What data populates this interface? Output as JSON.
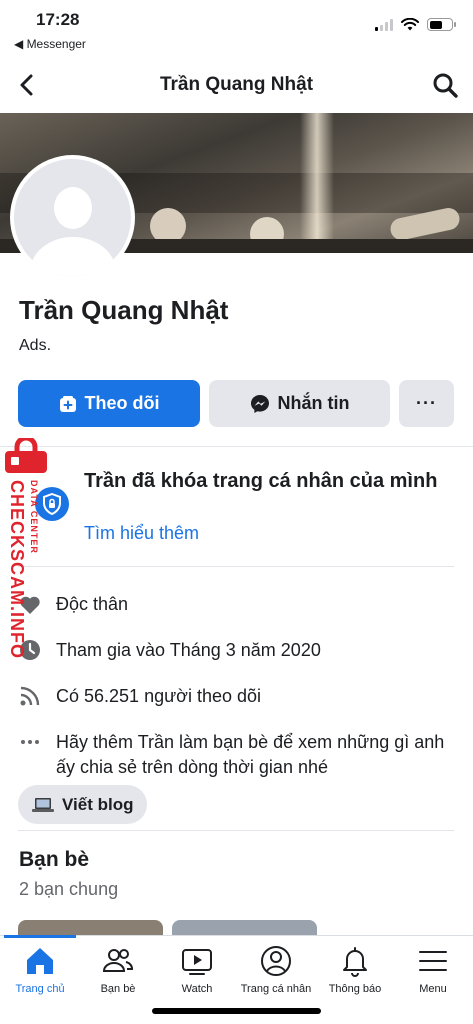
{
  "status_bar": {
    "time": "17:28",
    "back_app": "◀ Messenger",
    "signal_bars_filled": 1,
    "battery_level": 0.6
  },
  "header": {
    "title": "Trần Quang Nhật",
    "back_icon": "chevron-left-icon",
    "search_icon": "search-icon"
  },
  "profile": {
    "name": "Trần Quang Nhật",
    "subtitle": "Ads."
  },
  "actions": {
    "follow_label": "Theo dõi",
    "message_label": "Nhắn tin",
    "more_label": "···"
  },
  "locked_notice": {
    "title": "Trần đã khóa trang cá nhân của mình",
    "link": "Tìm hiểu thêm"
  },
  "details": [
    {
      "icon": "heart-icon",
      "text": "Độc thân"
    },
    {
      "icon": "clock-icon",
      "text": "Tham gia vào Tháng 3 năm 2020"
    },
    {
      "icon": "rss-icon",
      "text": "Có 56.251 người theo dõi"
    },
    {
      "icon": "ellipsis-icon",
      "text": "Hãy thêm Trần làm bạn bè để xem những gì anh ấy chia sẻ trên dòng thời gian nhé"
    }
  ],
  "blog_button": "Viết blog",
  "friends": {
    "title": "Bạn bè",
    "mutual": "2 bạn chung"
  },
  "watermark": {
    "main": "CHECKSCAM.INFO",
    "sub": "DATA CENTER"
  },
  "tabs": [
    {
      "label": "Trang chủ",
      "icon": "home-icon",
      "active": true
    },
    {
      "label": "Bạn bè",
      "icon": "friends-icon",
      "active": false
    },
    {
      "label": "Watch",
      "icon": "watch-icon",
      "active": false
    },
    {
      "label": "Trang cá nhân",
      "icon": "profile-icon",
      "active": false
    },
    {
      "label": "Thông báo",
      "icon": "bell-icon",
      "active": false
    },
    {
      "label": "Menu",
      "icon": "menu-icon",
      "active": false
    }
  ],
  "colors": {
    "accent": "#1b74e4",
    "watermark": "#e0242e",
    "button_gray": "#e4e6eb"
  }
}
